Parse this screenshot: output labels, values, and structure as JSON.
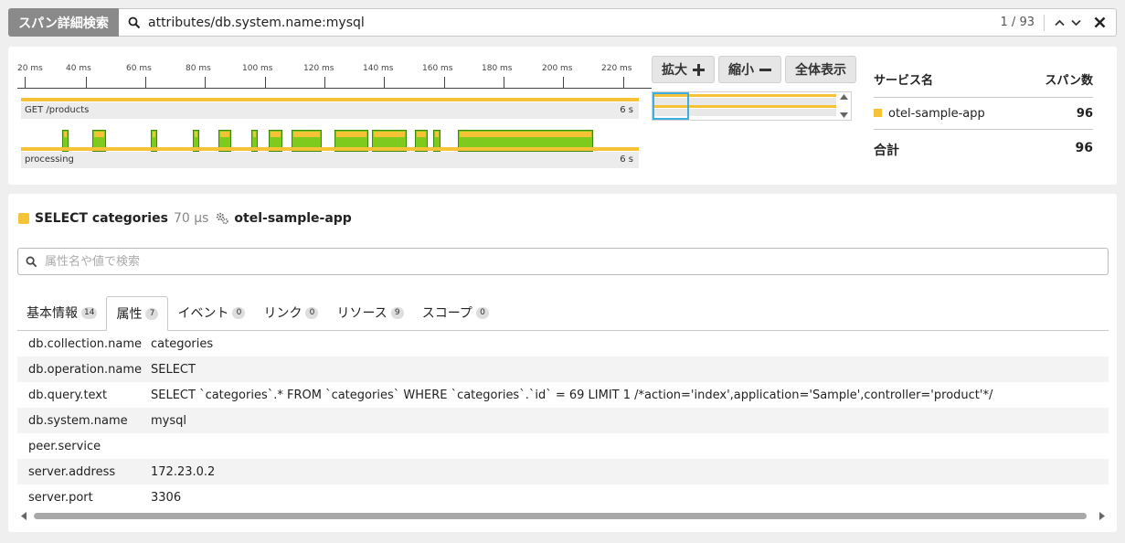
{
  "search": {
    "label": "スパン詳細検索",
    "query": "attributes/db.system.name:mysql",
    "count": "1 / 93"
  },
  "timeline": {
    "ticks": [
      "20 ms",
      "40 ms",
      "60 ms",
      "80 ms",
      "100 ms",
      "120 ms",
      "140 ms",
      "160 ms",
      "180 ms",
      "200 ms",
      "220 ms"
    ],
    "rows": [
      {
        "name": "GET /products",
        "duration": "6 s"
      },
      {
        "name": "processing",
        "duration": "6 s"
      }
    ]
  },
  "zoom": {
    "zoom_in": "拡大",
    "zoom_out": "縮小",
    "fit": "全体表示"
  },
  "services": {
    "col_service": "サービス名",
    "col_spans": "スパン数",
    "rows": [
      {
        "name": "otel-sample-app",
        "count": "96",
        "color": "#f5c335"
      }
    ],
    "total_label": "合計",
    "total_count": "96"
  },
  "span": {
    "name": "SELECT categories",
    "duration": "70 μs",
    "service": "otel-sample-app"
  },
  "attr_search": {
    "placeholder": "属性名や値で検索"
  },
  "tabs": [
    {
      "label": "基本情報",
      "count": "14"
    },
    {
      "label": "属性",
      "count": "7"
    },
    {
      "label": "イベント",
      "count": "0"
    },
    {
      "label": "リンク",
      "count": "0"
    },
    {
      "label": "リソース",
      "count": "9"
    },
    {
      "label": "スコープ",
      "count": "0"
    }
  ],
  "attributes": [
    {
      "key": "db.collection.name",
      "value": "categories"
    },
    {
      "key": "db.operation.name",
      "value": "SELECT"
    },
    {
      "key": "db.query.text",
      "value": "SELECT `categories`.* FROM `categories` WHERE `categories`.`id` = 69 LIMIT 1 /*action='index',application='Sample',controller='product'*/"
    },
    {
      "key": "db.system.name",
      "value": "mysql"
    },
    {
      "key": "peer.service",
      "value": ""
    },
    {
      "key": "server.address",
      "value": "172.23.0.2"
    },
    {
      "key": "server.port",
      "value": "3306"
    }
  ],
  "colors": {
    "span_yellow": "#f5c335",
    "span_green": "#7ecb1e",
    "selection_blue": "#3eaee0"
  }
}
